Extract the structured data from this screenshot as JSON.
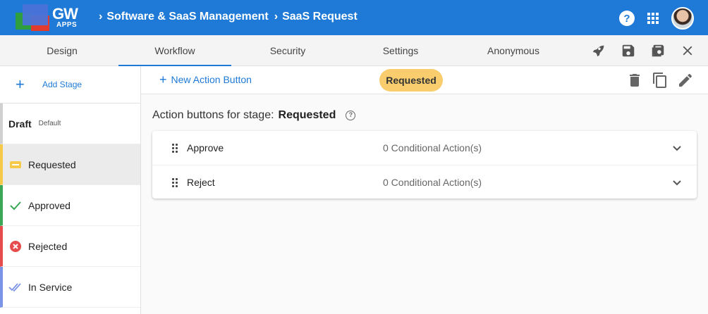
{
  "header": {
    "logo_text": "GW",
    "logo_sub": "APPS",
    "breadcrumbs": [
      "Software & SaaS Management",
      "SaaS Request"
    ],
    "icons": [
      "help-icon",
      "apps-grid-icon",
      "avatar"
    ]
  },
  "tabs": [
    {
      "label": "Design"
    },
    {
      "label": "Workflow",
      "active": true
    },
    {
      "label": "Security"
    },
    {
      "label": "Settings"
    },
    {
      "label": "Anonymous"
    }
  ],
  "tab_tools": [
    "rocket-icon",
    "save-icon",
    "save-as-icon",
    "close-icon"
  ],
  "sidebar": {
    "add_stage": "Add Stage",
    "stages": [
      {
        "name": "Draft",
        "sub": "Default",
        "color": "#d0d0d0"
      },
      {
        "name": "Requested",
        "icon": "badge-icon",
        "color": "#f7c948",
        "selected": true
      },
      {
        "name": "Approved",
        "icon": "check-icon",
        "color": "#3aa856"
      },
      {
        "name": "Rejected",
        "icon": "cancel-icon",
        "color": "#e74c4c"
      },
      {
        "name": "In Service",
        "icon": "double-check-icon",
        "color": "#7b93e6"
      }
    ]
  },
  "subbar": {
    "new_action": "New Action Button",
    "stage_pill": "Requested",
    "tools": [
      "delete-icon",
      "copy-icon",
      "edit-icon"
    ]
  },
  "main": {
    "heading_prefix": "Action buttons for stage:",
    "heading_stage": "Requested",
    "buttons": [
      {
        "name": "Approve",
        "conditions": "0 Conditional Action(s)"
      },
      {
        "name": "Reject",
        "conditions": "0 Conditional Action(s)"
      }
    ]
  },
  "colors": {
    "primary": "#1e7ad6",
    "pill": "#f9cd6e"
  }
}
